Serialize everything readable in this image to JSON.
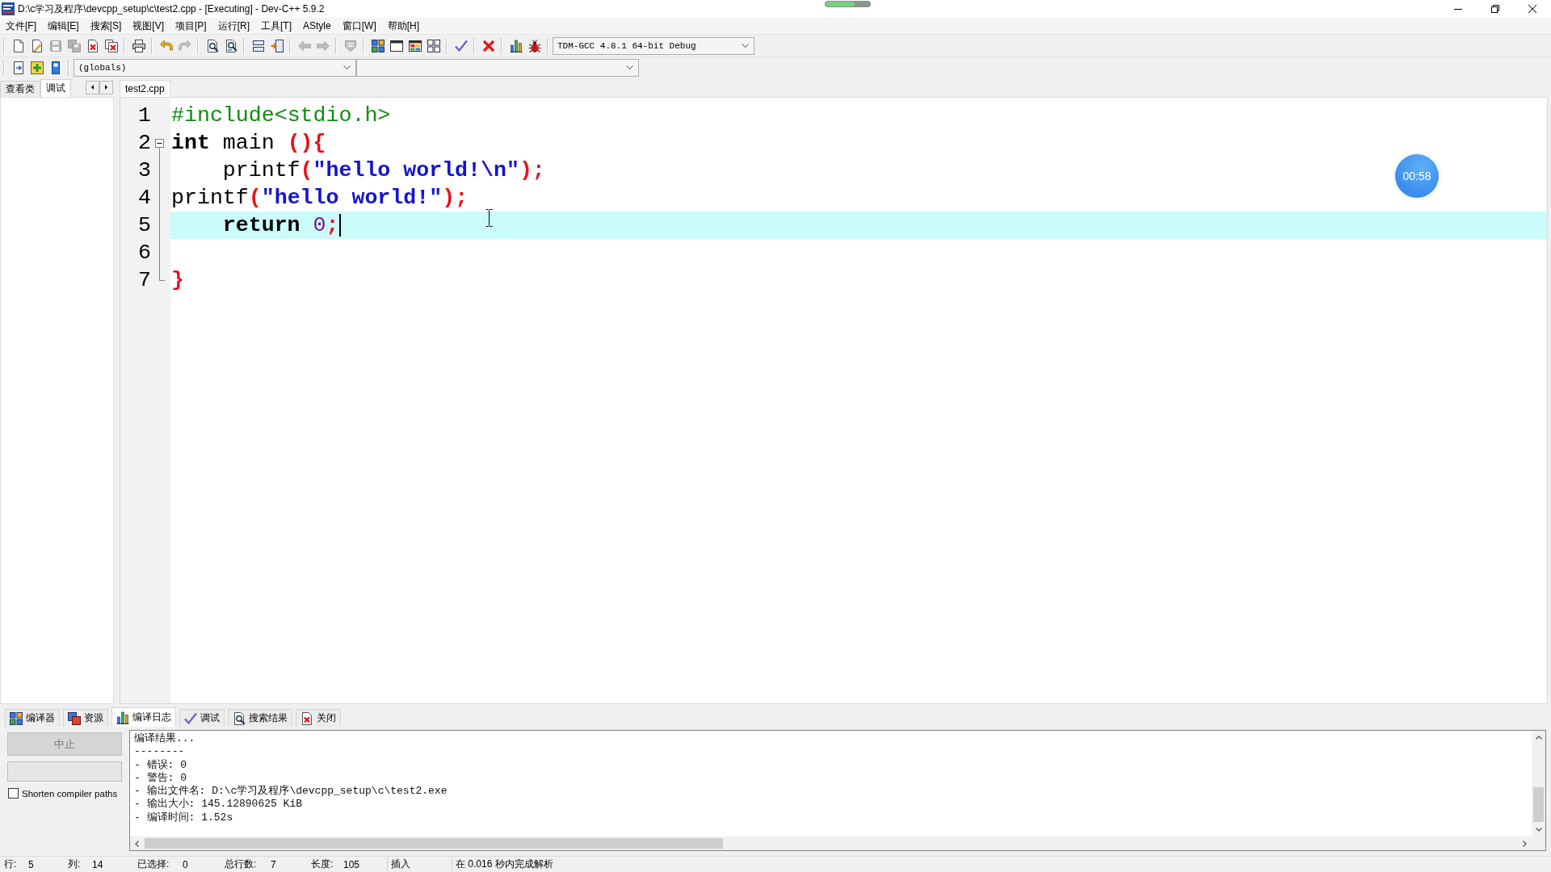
{
  "window": {
    "title": "D:\\c学习及程序\\devcpp_setup\\c\\test2.cpp - [Executing] - Dev-C++ 5.9.2"
  },
  "menu": [
    "文件[F]",
    "编辑[E]",
    "搜索[S]",
    "视图[V]",
    "项目[P]",
    "运行[R]",
    "工具[T]",
    "AStyle",
    "窗口[W]",
    "帮助[H]"
  ],
  "toolbar": {
    "groups": [
      [
        {
          "kind": "new",
          "disabled": false
        },
        {
          "kind": "open",
          "disabled": false
        },
        {
          "kind": "save",
          "disabled": true
        },
        {
          "kind": "saveall",
          "disabled": true
        },
        {
          "kind": "close",
          "disabled": false
        },
        {
          "kind": "closeall",
          "disabled": false
        }
      ],
      [
        {
          "kind": "print",
          "disabled": false
        }
      ],
      [
        {
          "kind": "undo",
          "disabled": false
        },
        {
          "kind": "redo",
          "disabled": true
        }
      ],
      [
        {
          "kind": "find",
          "disabled": false
        },
        {
          "kind": "replace",
          "disabled": false
        }
      ],
      [
        {
          "kind": "indent",
          "disabled": false
        },
        {
          "kind": "unindent",
          "disabled": false
        }
      ],
      [
        {
          "kind": "back",
          "disabled": true
        },
        {
          "kind": "forward",
          "disabled": true
        }
      ],
      [
        {
          "kind": "gotoline",
          "disabled": true
        }
      ],
      [
        {
          "kind": "compile",
          "disabled": false
        },
        {
          "kind": "run",
          "disabled": false
        },
        {
          "kind": "compilerun",
          "disabled": false
        },
        {
          "kind": "rebuild",
          "disabled": false
        }
      ],
      [
        {
          "kind": "syntax",
          "disabled": false
        }
      ],
      [
        {
          "kind": "stop",
          "disabled": false
        }
      ],
      [
        {
          "kind": "profile",
          "disabled": false
        },
        {
          "kind": "debug",
          "disabled": false
        }
      ]
    ],
    "compiler": "TDM-GCC 4.8.1 64-bit Debug"
  },
  "class_bar": {
    "tools": [
      {
        "kind": "newclass",
        "disabled": false
      },
      {
        "kind": "insert",
        "disabled": false
      },
      {
        "kind": "bookmark",
        "disabled": false
      }
    ],
    "scope": "(globals)"
  },
  "side_panel": {
    "tabs": [
      {
        "label": "查看类",
        "selected": false
      },
      {
        "label": "调试",
        "selected": true
      }
    ]
  },
  "editor": {
    "tabs": [
      {
        "label": "test2.cpp",
        "selected": true
      }
    ],
    "lines": [
      {
        "number": "1",
        "current": false,
        "indented": false,
        "tokens": [
          {
            "kind": "preprocessor",
            "text": "#include<stdio.h>"
          }
        ]
      },
      {
        "number": "2",
        "current": false,
        "indented": false,
        "expanded": true,
        "tokens": [
          {
            "kind": "keyword",
            "text": "int"
          },
          {
            "kind": "plain",
            "text": " main "
          },
          {
            "kind": "symbol",
            "text": "(){"
          }
        ],
        "children": [
          {
            "number": "3",
            "current": false,
            "indented": true,
            "tokens": [
              {
                "kind": "plain",
                "text": "printf"
              },
              {
                "kind": "symbol",
                "text": "("
              },
              {
                "kind": "string",
                "text": "\"hello world!\\n\""
              },
              {
                "kind": "symbol",
                "text": ");"
              }
            ]
          },
          {
            "number": "4",
            "current": false,
            "indented": false,
            "tokens": [
              {
                "kind": "plain",
                "text": "printf"
              },
              {
                "kind": "symbol",
                "text": "("
              },
              {
                "kind": "string",
                "text": "\"hello world!\""
              },
              {
                "kind": "symbol",
                "text": ");"
              }
            ]
          },
          {
            "number": "5",
            "current": true,
            "indented": true,
            "tokens": [
              {
                "kind": "keyword",
                "text": "return"
              },
              {
                "kind": "number",
                "text": " 0"
              },
              {
                "kind": "symbol",
                "text": ";"
              }
            ]
          },
          {
            "number": "6",
            "current": false
          },
          {
            "number": "7",
            "current": false,
            "indented": false,
            "tokens": [
              {
                "kind": "symbol",
                "text": "}"
              }
            ]
          }
        ]
      }
    ]
  },
  "bottom_panel": {
    "tabs": [
      {
        "kind": "compiler",
        "label": "编译器",
        "selected": false
      },
      {
        "kind": "resources",
        "label": "资源",
        "selected": false
      },
      {
        "kind": "log",
        "label": "编译日志",
        "selected": true
      },
      {
        "kind": "debug",
        "label": "调试",
        "selected": false
      },
      {
        "kind": "search",
        "label": "搜索结果",
        "selected": false
      },
      {
        "kind": "close",
        "label": "关闭",
        "selected": false
      }
    ],
    "abort_button": {
      "label": "中止",
      "disabled": true
    },
    "progress": {
      "level": 0
    },
    "shorten_paths": {
      "label": "Shorten compiler paths",
      "checked": false
    },
    "log": [
      "编译结果...",
      "--------",
      "- 错误: 0",
      "- 警告: 0",
      "- 输出文件名: D:\\c学习及程序\\devcpp_setup\\c\\test2.exe",
      "- 输出大小: 145.12890625 KiB",
      "- 编译时间: 1.52s"
    ]
  },
  "status_bar": [
    {
      "label": "行:",
      "value": "5"
    },
    {
      "label": "列:",
      "value": "14"
    },
    {
      "label": "已选择:",
      "value": "0"
    },
    {
      "label": "总行数:",
      "value": "7"
    },
    {
      "label": "长度:",
      "value": "105"
    },
    {
      "label": "插入"
    },
    {
      "label": "在 0.016 秒内完成解析"
    }
  ],
  "overlay": {
    "timer": "00:58"
  }
}
